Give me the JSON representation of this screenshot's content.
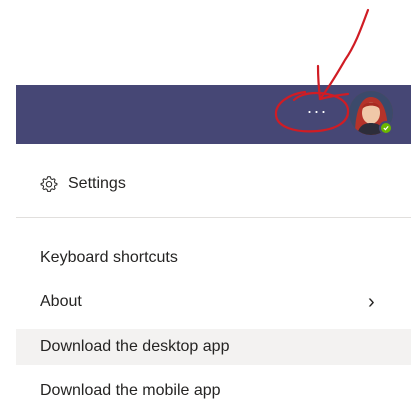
{
  "topbar": {
    "more_label": "···",
    "more_icon": "more-options-icon",
    "avatar_presence": "available",
    "background": "#464775"
  },
  "menu": {
    "settings": {
      "label": "Settings",
      "icon": "gear-icon"
    },
    "keyboard_shortcuts": "Keyboard shortcuts",
    "about": {
      "label": "About",
      "chevron": "›"
    },
    "download_desktop": "Download the desktop app",
    "download_mobile": "Download the mobile app"
  },
  "colors": {
    "annotation": "#d01c24",
    "presence": "#6bb700",
    "hover": "#f3f2f1"
  }
}
